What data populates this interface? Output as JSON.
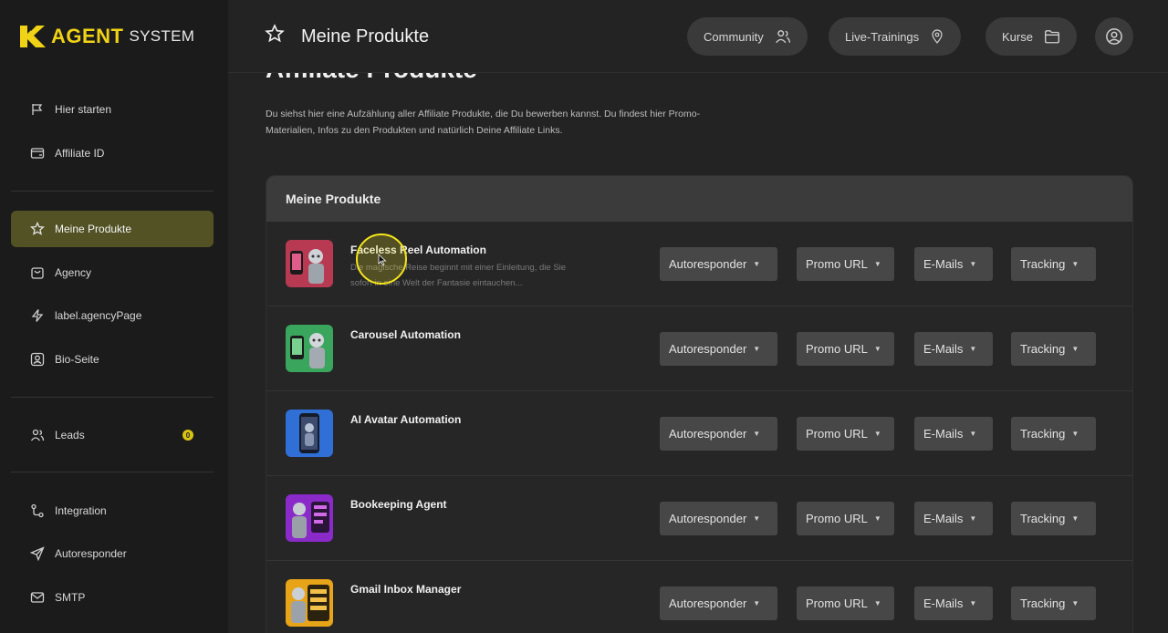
{
  "logo": {
    "brand": "AGENT",
    "sub": "SYSTEM"
  },
  "sidebar": {
    "items": [
      {
        "label": "Hier starten",
        "icon": "flag-icon"
      },
      {
        "label": "Affiliate ID",
        "icon": "card-icon"
      },
      {
        "label": "Meine Produkte",
        "icon": "star-icon",
        "active": true
      },
      {
        "label": "Agency",
        "icon": "bag-icon"
      },
      {
        "label": "label.agencyPage",
        "icon": "bolt-icon"
      },
      {
        "label": "Bio-Seite",
        "icon": "profile-icon"
      },
      {
        "label": "Leads",
        "icon": "users-icon",
        "badge": "0"
      },
      {
        "label": "Integration",
        "icon": "integration-icon"
      },
      {
        "label": "Autoresponder",
        "icon": "send-icon"
      },
      {
        "label": "SMTP",
        "icon": "mail-icon"
      }
    ]
  },
  "header": {
    "title": "Meine Produkte",
    "buttons": [
      {
        "label": "Community",
        "icon": "community-icon"
      },
      {
        "label": "Live-Trainings",
        "icon": "location-pin-icon"
      },
      {
        "label": "Kurse",
        "icon": "folder-icon"
      }
    ],
    "avatar_icon": "user-circle-icon"
  },
  "main": {
    "heading": "Affiliate Produkte",
    "description": "Du siehst hier eine Aufzählung aller Affiliate Produkte, die Du bewerben kannst. Du findest hier Promo-Materialien, Infos zu den Produkten und natürlich Deine Affiliate Links.",
    "panel_title": "Meine Produkte",
    "dropdowns": [
      "Autoresponder",
      "Promo URL",
      "E-Mails",
      "Tracking"
    ],
    "products": [
      {
        "name": "Faceless Reel Automation",
        "desc": "Die magische Reise beginnt mit einer Einleitung, die Sie sofort in eine Welt der Fantasie eintauchen..."
      },
      {
        "name": "Carousel Automation",
        "desc": ""
      },
      {
        "name": "AI Avatar Automation",
        "desc": ""
      },
      {
        "name": "Bookeeping Agent",
        "desc": ""
      },
      {
        "name": "Gmail Inbox Manager",
        "desc": ""
      }
    ]
  },
  "colors": {
    "accent": "#f0d316",
    "active_nav": "#525225",
    "dropdown": "#474747"
  }
}
